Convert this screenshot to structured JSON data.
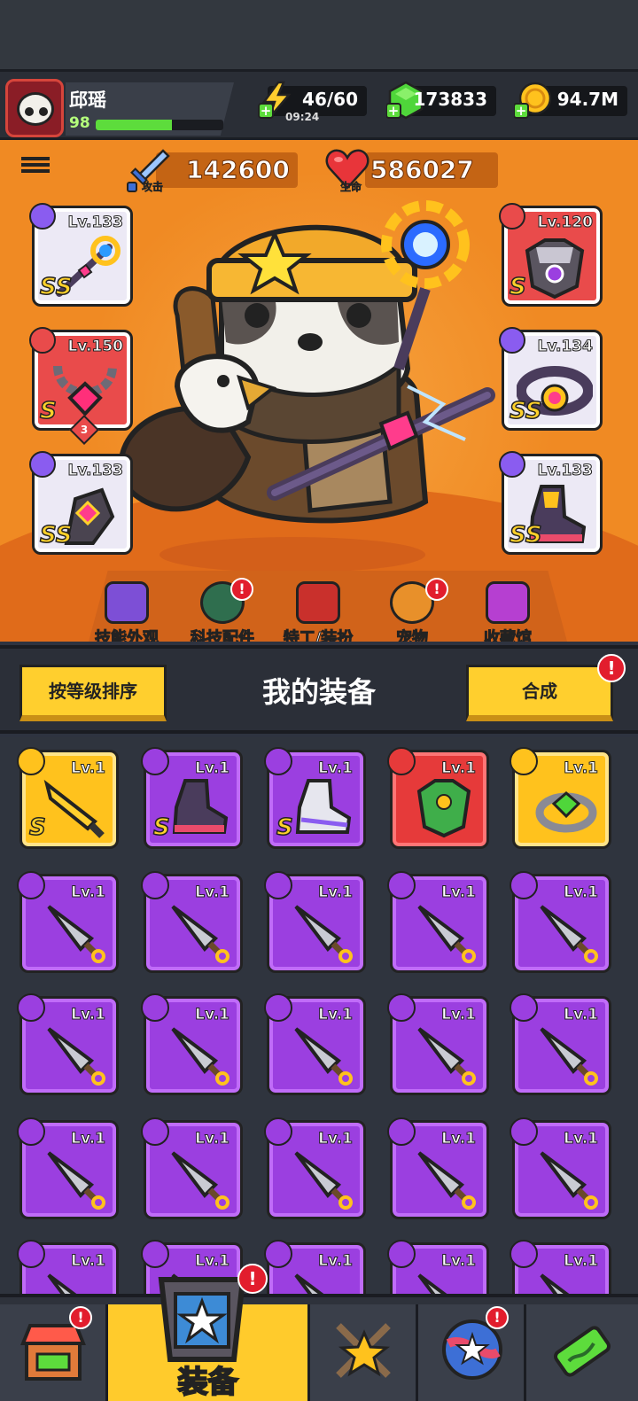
{
  "player": {
    "name": "邱瑶",
    "level": "98",
    "xp_fraction": 0.6
  },
  "resources": {
    "energy": {
      "value": "46/60",
      "timer": "09:24",
      "icon": "lightning-plus-icon"
    },
    "gems": {
      "value": "173833",
      "icon": "green-gem-plus-icon"
    },
    "coins": {
      "value": "94.7M",
      "icon": "gold-coin-plus-icon"
    }
  },
  "stats": {
    "attack": {
      "value": "142600",
      "label": "攻击",
      "icon": "sword-icon"
    },
    "health": {
      "value": "586027",
      "label": "生命",
      "icon": "heart-icon"
    }
  },
  "equipped": {
    "weapon": {
      "level": "Lv.133",
      "rank": "SS",
      "icon": "staff-icon"
    },
    "necklace": {
      "level": "Lv.150",
      "rank": "S",
      "stars": "3",
      "icon": "chain-necklace-icon"
    },
    "gloves": {
      "level": "Lv.133",
      "rank": "SS",
      "icon": "gauntlet-icon"
    },
    "armor": {
      "level": "Lv.120",
      "rank": "S",
      "icon": "armor-icon"
    },
    "belt": {
      "level": "Lv.134",
      "rank": "SS",
      "icon": "belt-icon"
    },
    "boots": {
      "level": "Lv.133",
      "rank": "SS",
      "icon": "boots-icon"
    }
  },
  "features": [
    {
      "label": "技能外观",
      "icon": "skill-skin-icon",
      "badge": false
    },
    {
      "label": "科技配件",
      "icon": "tech-part-icon",
      "badge": true
    },
    {
      "label": "特工/装扮",
      "icon": "agent-icon",
      "badge": false
    },
    {
      "label": "宠物",
      "icon": "pet-shiba-icon",
      "badge": true
    },
    {
      "label": "收藏馆",
      "icon": "collection-chest-icon",
      "badge": false
    }
  ],
  "equipment_header": {
    "sort_label": "按等级排序",
    "title": "我的装备",
    "merge_label": "合成",
    "badge": "!"
  },
  "inventory": [
    {
      "level": "Lv.1",
      "rarity": "gold",
      "rank": "S",
      "icon": "sword-icon"
    },
    {
      "level": "Lv.1",
      "rarity": "purple",
      "rank": "S",
      "icon": "dark-boots-icon"
    },
    {
      "level": "Lv.1",
      "rarity": "purple",
      "rank": "S",
      "icon": "silver-boots-icon"
    },
    {
      "level": "Lv.1",
      "rarity": "red",
      "rank": "",
      "icon": "green-armor-icon"
    },
    {
      "level": "Lv.1",
      "rarity": "gold",
      "rank": "",
      "icon": "emerald-ring-icon"
    },
    {
      "level": "Lv.1",
      "rarity": "purple",
      "rank": "",
      "icon": "kunai-icon"
    },
    {
      "level": "Lv.1",
      "rarity": "purple",
      "rank": "",
      "icon": "kunai-icon"
    },
    {
      "level": "Lv.1",
      "rarity": "purple",
      "rank": "",
      "icon": "kunai-icon"
    },
    {
      "level": "Lv.1",
      "rarity": "purple",
      "rank": "",
      "icon": "kunai-icon"
    },
    {
      "level": "Lv.1",
      "rarity": "purple",
      "rank": "",
      "icon": "kunai-icon"
    },
    {
      "level": "Lv.1",
      "rarity": "purple",
      "rank": "",
      "icon": "kunai-icon"
    },
    {
      "level": "Lv.1",
      "rarity": "purple",
      "rank": "",
      "icon": "kunai-icon"
    },
    {
      "level": "Lv.1",
      "rarity": "purple",
      "rank": "",
      "icon": "kunai-icon"
    },
    {
      "level": "Lv.1",
      "rarity": "purple",
      "rank": "",
      "icon": "kunai-icon"
    },
    {
      "level": "Lv.1",
      "rarity": "purple",
      "rank": "",
      "icon": "kunai-icon"
    },
    {
      "level": "Lv.1",
      "rarity": "purple",
      "rank": "",
      "icon": "kunai-icon"
    },
    {
      "level": "Lv.1",
      "rarity": "purple",
      "rank": "",
      "icon": "kunai-icon"
    },
    {
      "level": "Lv.1",
      "rarity": "purple",
      "rank": "",
      "icon": "kunai-icon"
    },
    {
      "level": "Lv.1",
      "rarity": "purple",
      "rank": "",
      "icon": "kunai-icon"
    },
    {
      "level": "Lv.1",
      "rarity": "purple",
      "rank": "",
      "icon": "kunai-icon"
    },
    {
      "level": "Lv.1",
      "rarity": "purple",
      "rank": "",
      "icon": "kunai-icon"
    },
    {
      "level": "Lv.1",
      "rarity": "purple",
      "rank": "",
      "icon": "kunai-icon"
    },
    {
      "level": "Lv.1",
      "rarity": "purple",
      "rank": "",
      "icon": "kunai-icon"
    },
    {
      "level": "Lv.1",
      "rarity": "purple",
      "rank": "",
      "icon": "kunai-icon"
    },
    {
      "level": "Lv.1",
      "rarity": "purple",
      "rank": "",
      "icon": "kunai-icon"
    }
  ],
  "bottom_nav": [
    {
      "name": "shop",
      "icon": "shop-icon",
      "label": "",
      "badge": true
    },
    {
      "name": "equipment",
      "icon": "equipment-icon",
      "label": "装备",
      "badge": true,
      "active": true
    },
    {
      "name": "battle",
      "icon": "crossed-swords-star-icon",
      "label": "",
      "badge": false
    },
    {
      "name": "talent",
      "icon": "star-orb-icon",
      "label": "",
      "badge": true
    },
    {
      "name": "evolve",
      "icon": "dna-capsule-icon",
      "label": "",
      "badge": false
    }
  ],
  "colors": {
    "orange_bg": "#f08a23",
    "purple_rarity": "#9b3fe0",
    "gold_rarity": "#ffc21d",
    "red_rarity": "#e63a3a",
    "yellow_button": "#ffcf2e"
  }
}
